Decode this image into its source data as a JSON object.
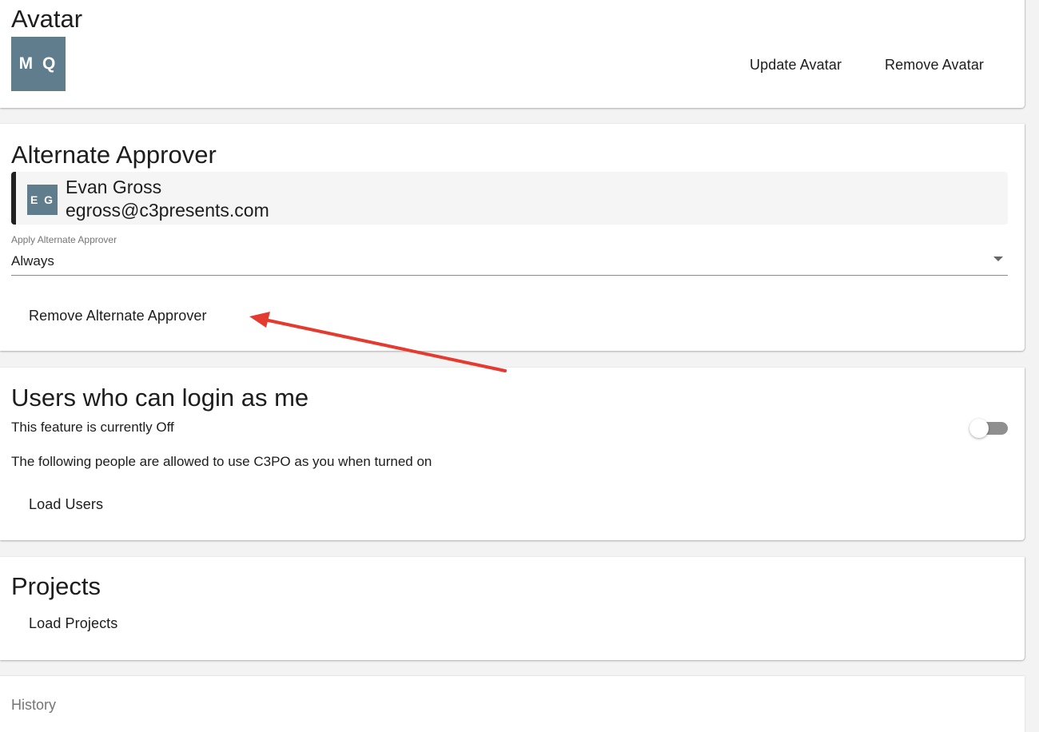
{
  "avatar_section": {
    "title": "Avatar",
    "initials": "M Q",
    "avatar_color": "#5f7d8c",
    "update_label": "Update Avatar",
    "remove_label": "Remove Avatar"
  },
  "approver_section": {
    "title": "Alternate Approver",
    "approver": {
      "initials": "E G",
      "name": "Evan Gross",
      "email": "egross@c3presents.com"
    },
    "select_label": "Apply Alternate Approver",
    "select_value": "Always",
    "remove_label": "Remove Alternate Approver"
  },
  "login_section": {
    "title": "Users who can login as me",
    "status_text": "This feature is currently Off",
    "toggle_on": false,
    "description": "The following people are allowed to use C3PO as you when turned on",
    "load_label": "Load Users"
  },
  "projects_section": {
    "title": "Projects",
    "load_label": "Load Projects"
  },
  "history_section": {
    "label": "History"
  },
  "annotation": {
    "arrow_color": "#e53a2f"
  }
}
